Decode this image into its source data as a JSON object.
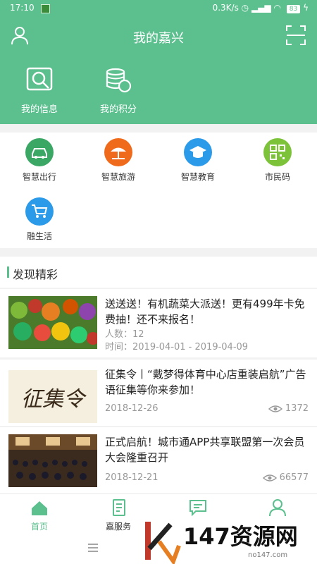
{
  "status_bar": {
    "time": "17:10",
    "network_speed": "0.3K/s",
    "battery": "83"
  },
  "header": {
    "title": "我的嘉兴"
  },
  "shortcuts": [
    {
      "label": "我的信息"
    },
    {
      "label": "我的积分"
    }
  ],
  "services": [
    {
      "label": "智慧出行",
      "color": "#3aa864",
      "icon": "car-icon"
    },
    {
      "label": "智慧旅游",
      "color": "#f06a1c",
      "icon": "beach-umbrella-icon"
    },
    {
      "label": "智慧教育",
      "color": "#2b9ae8",
      "icon": "graduation-cap-icon"
    },
    {
      "label": "市民码",
      "color": "#7cc33a",
      "icon": "qr-code-icon"
    },
    {
      "label": "融生活",
      "color": "#2b9ae8",
      "icon": "shopping-cart-icon"
    }
  ],
  "discover": {
    "title": "发现精彩"
  },
  "news": [
    {
      "title": "送送送！有机蔬菜大派送！更有499年卡免费抽！还不来报名！",
      "participants": "人数：12",
      "period": "时间：2019-04-01 - 2019-04-09",
      "thumb_text": ""
    },
    {
      "title": "征集令丨“戴梦得体育中心店重装启航”广告语征集等你来参加！",
      "date": "2018-12-26",
      "views": "1372",
      "thumb_text": "征集令"
    },
    {
      "title": "正式启航！城市通APP共享联盟第一次会员大会隆重召开",
      "date": "2018-12-21",
      "views": "66577",
      "thumb_text": ""
    }
  ],
  "tabs": [
    {
      "label": "首页",
      "active": true
    },
    {
      "label": "嘉服务"
    },
    {
      "label": ""
    },
    {
      "label": ""
    }
  ],
  "watermark": {
    "site": "147资源网",
    "domain": "no147.com"
  },
  "colors": {
    "accent": "#5bbf8e",
    "meta_text": "#999999"
  }
}
